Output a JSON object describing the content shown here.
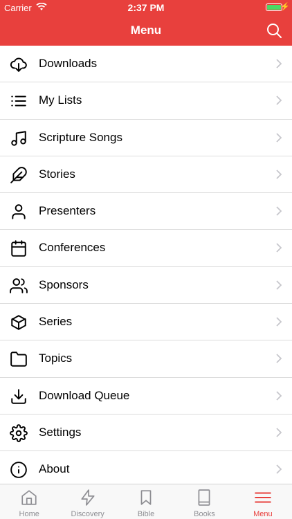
{
  "status": {
    "carrier": "Carrier",
    "time": "2:37 PM"
  },
  "header": {
    "title": "Menu"
  },
  "menu": [
    {
      "label": "Downloads",
      "icon": "cloud-download-icon"
    },
    {
      "label": "My Lists",
      "icon": "list-icon"
    },
    {
      "label": "Scripture Songs",
      "icon": "music-note-icon"
    },
    {
      "label": "Stories",
      "icon": "feather-icon"
    },
    {
      "label": "Presenters",
      "icon": "person-icon"
    },
    {
      "label": "Conferences",
      "icon": "calendar-icon"
    },
    {
      "label": "Sponsors",
      "icon": "people-icon"
    },
    {
      "label": "Series",
      "icon": "box-icon"
    },
    {
      "label": "Topics",
      "icon": "folder-icon"
    },
    {
      "label": "Download Queue",
      "icon": "download-icon"
    },
    {
      "label": "Settings",
      "icon": "gear-icon"
    },
    {
      "label": "About",
      "icon": "info-icon"
    }
  ],
  "tabs": [
    {
      "label": "Home",
      "icon": "home-icon"
    },
    {
      "label": "Discovery",
      "icon": "lightning-icon"
    },
    {
      "label": "Bible",
      "icon": "bookmark-icon"
    },
    {
      "label": "Books",
      "icon": "book-icon"
    },
    {
      "label": "Menu",
      "icon": "hamburger-icon",
      "active": true
    }
  ],
  "colors": {
    "accent": "#e8403d",
    "tab_inactive": "#8e8e93",
    "battery": "#4cd964"
  }
}
